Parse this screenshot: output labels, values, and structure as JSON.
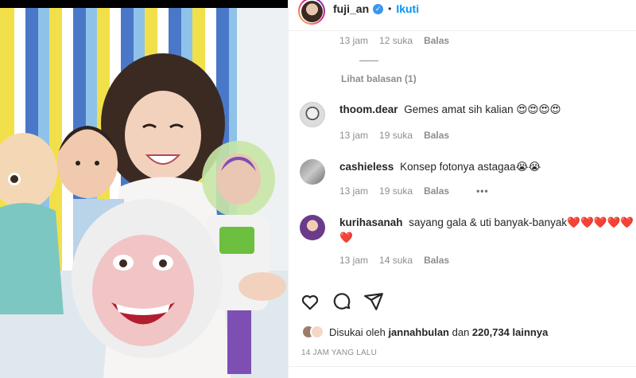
{
  "header": {
    "username": "fuji_an",
    "dot": "•",
    "follow": "Ikuti"
  },
  "top_reply_meta": {
    "time": "13 jam",
    "likes": "12 suka",
    "reply": "Balas"
  },
  "view_replies": "Lihat balasan (1)",
  "comments": [
    {
      "user": "thoom.dear",
      "text": "Gemes amat sih kalian 😍😍😍😍",
      "time": "13 jam",
      "likes": "19 suka",
      "reply": "Balas"
    },
    {
      "user": "cashieless",
      "text": "Konsep fotonya astagaa😭😭",
      "time": "13 jam",
      "likes": "19 suka",
      "reply": "Balas",
      "more": "•••"
    },
    {
      "user": "kurihasanah",
      "text": "sayang gala & uti banyak-banyak❤️❤️❤️❤️❤️❤️",
      "time": "13 jam",
      "likes": "14 suka",
      "reply": "Balas"
    }
  ],
  "likes": {
    "prefix": "Disukai oleh ",
    "user": "jannahbulan",
    "middle": " dan ",
    "count": "220,734",
    "suffix": " lainnya"
  },
  "time_ago": "14 JAM YANG LALU",
  "icons": [
    "heart-icon",
    "comment-icon",
    "share-icon",
    "verified-icon"
  ],
  "colors": {
    "link": "#0095f6",
    "verified": "#3897f0",
    "muted": "#8e8e8e"
  }
}
